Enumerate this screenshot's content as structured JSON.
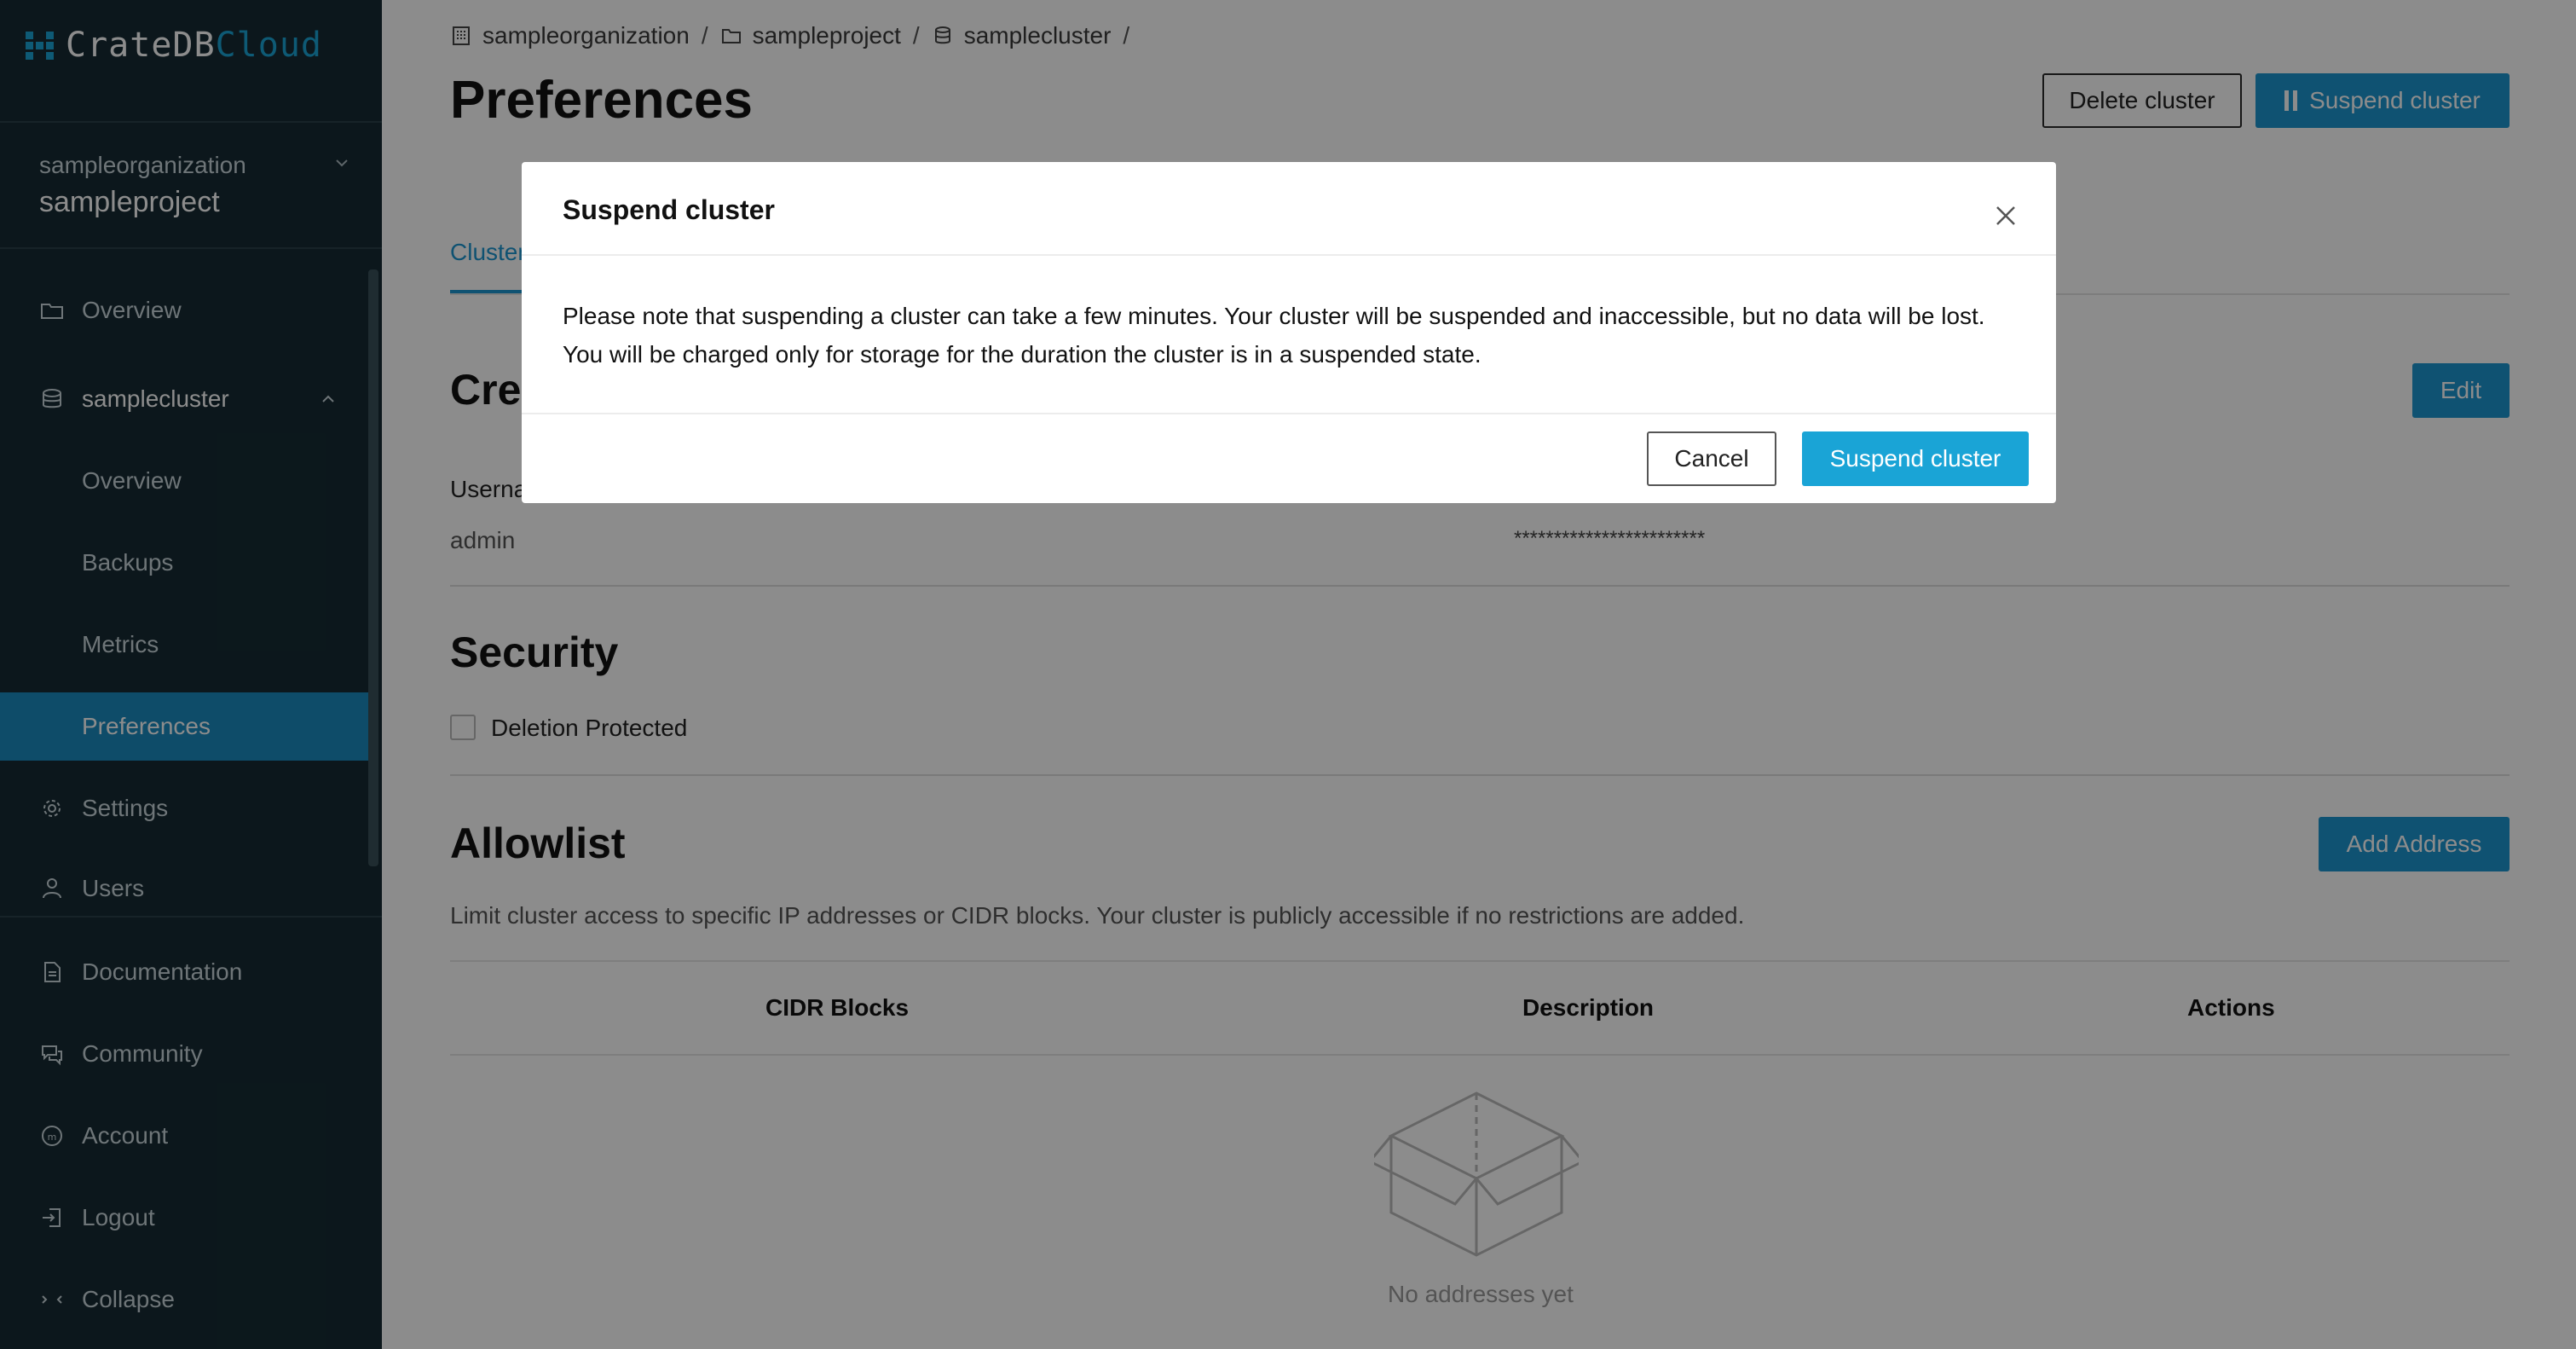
{
  "brand": {
    "name_part1": "CrateDB",
    "name_part2": "Cloud",
    "accent": "#1aa4d6"
  },
  "sidebar": {
    "organization": "sampleorganization",
    "project": "sampleproject",
    "items": [
      {
        "label": "Overview",
        "icon": "folder-icon"
      },
      {
        "label": "samplecluster",
        "icon": "database-icon"
      },
      {
        "label": "Overview"
      },
      {
        "label": "Backups"
      },
      {
        "label": "Metrics"
      },
      {
        "label": "Preferences",
        "active": true
      },
      {
        "label": "Settings",
        "icon": "gear-icon"
      },
      {
        "label": "Users",
        "icon": "user-icon"
      }
    ],
    "bottom": [
      {
        "label": "Documentation",
        "icon": "document-icon"
      },
      {
        "label": "Community",
        "icon": "chat-icon"
      },
      {
        "label": "Account",
        "icon": "account-icon"
      },
      {
        "label": "Logout",
        "icon": "logout-icon"
      },
      {
        "label": "Collapse",
        "icon": "collapse-icon"
      }
    ]
  },
  "breadcrumb": {
    "org": "sampleorganization",
    "project": "sampleproject",
    "cluster": "samplecluster",
    "sep": "/"
  },
  "header": {
    "title": "Preferences",
    "delete_label": "Delete cluster",
    "suspend_label": "Suspend cluster"
  },
  "tabs": {
    "active": "Cluster"
  },
  "credentials": {
    "title": "Credentials",
    "edit_label": "Edit",
    "username_label": "Username",
    "username_value": "admin",
    "password_value": "************************"
  },
  "security": {
    "title": "Security",
    "deletion_protected_label": "Deletion Protected",
    "deletion_protected_checked": false
  },
  "allowlist": {
    "title": "Allowlist",
    "add_label": "Add Address",
    "description": "Limit cluster access to specific IP addresses or CIDR blocks. Your cluster is publicly accessible if no restrictions are added.",
    "columns": [
      "CIDR Blocks",
      "Description",
      "Actions"
    ],
    "empty_text": "No addresses yet"
  },
  "modal": {
    "title": "Suspend cluster",
    "body_line1": "Please note that suspending a cluster can take a few minutes. Your cluster will be suspended and inaccessible, but no data will be lost.",
    "body_line2": "You will be charged only for storage for the duration the cluster is in a suspended state.",
    "cancel_label": "Cancel",
    "confirm_label": "Suspend cluster"
  }
}
